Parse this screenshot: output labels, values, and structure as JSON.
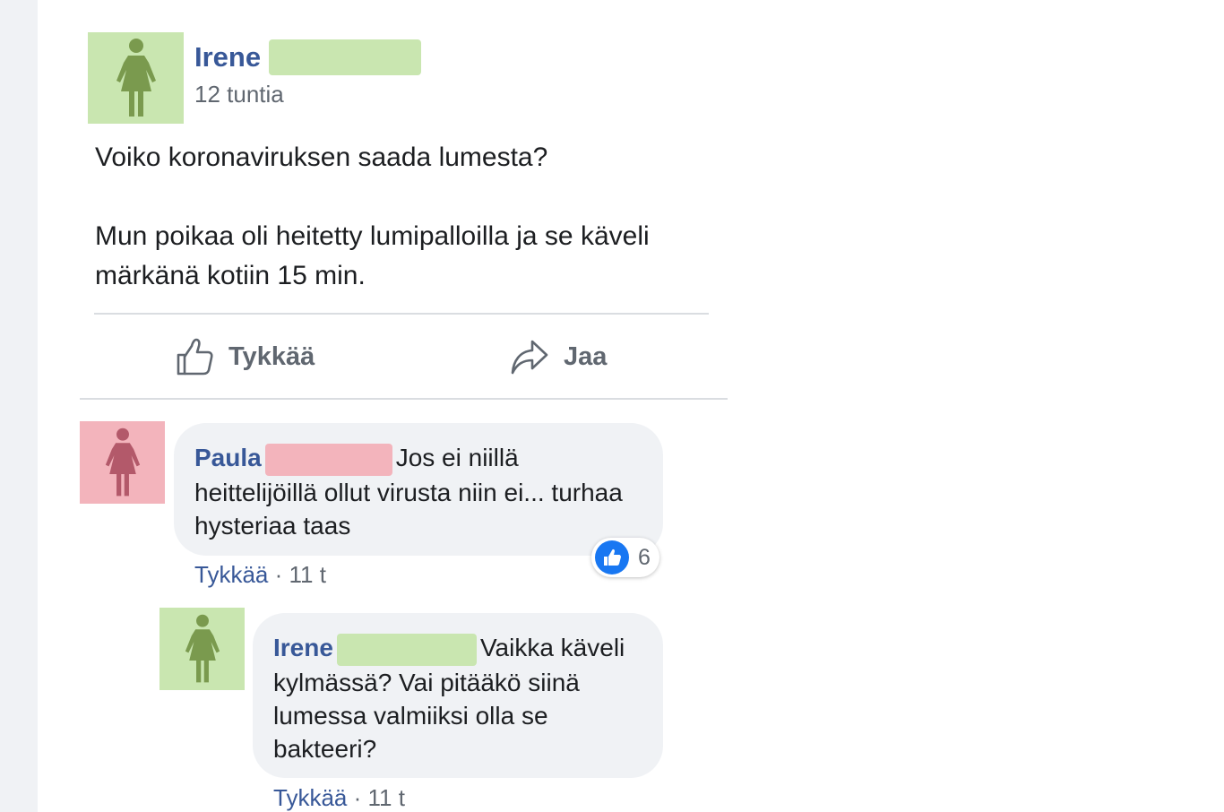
{
  "post": {
    "author": "Irene",
    "time": "12 tuntia",
    "text_line1": "Voiko koronaviruksen saada lumesta?",
    "text_line2": "Mun poikaa oli heitetty lumipalloilla ja se käveli märkänä kotiin 15 min.",
    "avatar_icon": "female-person-icon",
    "like_label": "Tykkää",
    "share_label": "Jaa"
  },
  "comments": [
    {
      "author": "Paula",
      "text": "Jos ei niillä heittelijöillä ollut virusta niin ei... turhaa hysteriaa taas",
      "like_label": "Tykkää",
      "separator": " · ",
      "time": "11 t",
      "reaction_count": "6",
      "avatar_icon": "female-person-icon"
    },
    {
      "author": "Irene",
      "text": "Vaikka käveli kylmässä? Vai pitääkö siinä lumessa valmiiksi olla se bakteeri?",
      "like_label": "Tykkää",
      "separator": " · ",
      "time": "11 t",
      "avatar_icon": "female-person-icon"
    }
  ],
  "colors": {
    "name_link": "#385898",
    "redact_green": "#c9e6b0",
    "redact_pink": "#f3b4bc",
    "like_blue": "#1877f2"
  }
}
